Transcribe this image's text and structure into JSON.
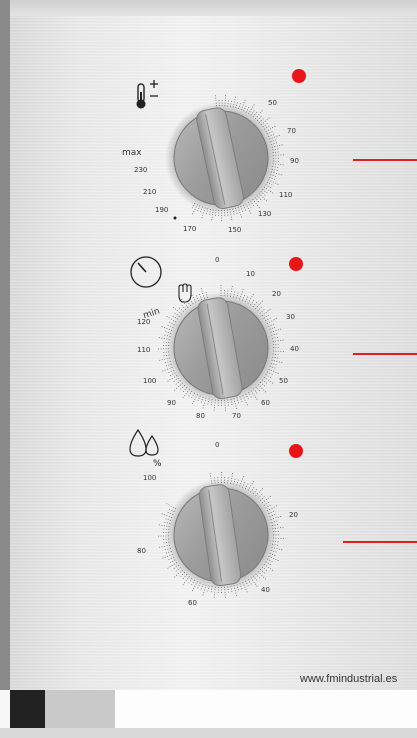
{
  "panel": {
    "website": "www.fmindustrial.es",
    "indicator_color": "#e8151b",
    "line_color": "#e02020"
  },
  "knobs": [
    {
      "name": "temperature",
      "icon": "thermometer-plus-minus-icon",
      "labels": [
        "50",
        "70",
        "90",
        "110",
        "130",
        "150",
        "170",
        "190",
        "210",
        "230",
        "max"
      ]
    },
    {
      "name": "timer",
      "icon": "timer-icon",
      "labels": [
        "0",
        "10",
        "20",
        "30",
        "40",
        "50",
        "60",
        "70",
        "80",
        "90",
        "100",
        "110",
        "120",
        "min"
      ],
      "manual_icon": "hand-icon"
    },
    {
      "name": "humidity",
      "icon": "humidity-drops-icon",
      "labels": [
        "0",
        "20",
        "40",
        "60",
        "80",
        "100"
      ],
      "unit": "%"
    }
  ]
}
